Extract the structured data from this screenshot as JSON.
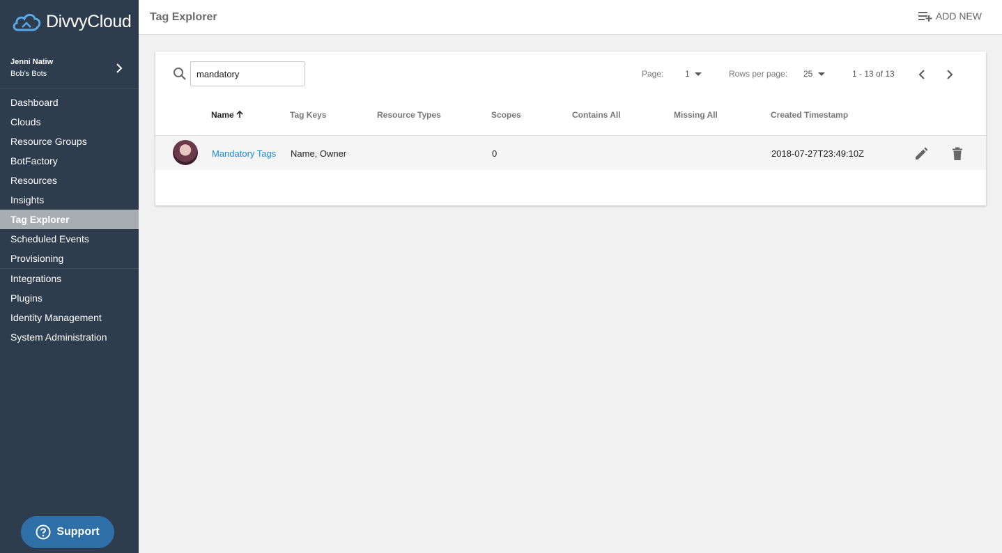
{
  "brand": {
    "name": "DivvyCloud"
  },
  "user": {
    "name": "Jenni Natiw",
    "org": "Bob's Bots"
  },
  "sidebar": {
    "items": [
      {
        "label": "Dashboard"
      },
      {
        "label": "Clouds"
      },
      {
        "label": "Resource Groups"
      },
      {
        "label": "BotFactory"
      },
      {
        "label": "Resources"
      },
      {
        "label": "Insights"
      },
      {
        "label": "Tag Explorer",
        "active": true
      },
      {
        "label": "Scheduled Events"
      },
      {
        "label": "Provisioning"
      },
      {
        "label": "Integrations"
      },
      {
        "label": "Plugins"
      },
      {
        "label": "Identity Management"
      },
      {
        "label": "System Administration"
      }
    ],
    "support_label": "Support"
  },
  "header": {
    "title": "Tag Explorer",
    "add_new_label": "ADD NEW"
  },
  "search": {
    "value": "mandatory"
  },
  "pager": {
    "page_label": "Page:",
    "page_value": "1",
    "rows_label": "Rows per page:",
    "rows_value": "25",
    "range_text": "1 - 13 of 13"
  },
  "table": {
    "columns": [
      "Name",
      "Tag Keys",
      "Resource Types",
      "Scopes",
      "Contains All",
      "Missing All",
      "Created Timestamp"
    ],
    "sorted_column": "Name",
    "sort_direction": "ascending",
    "rows": [
      {
        "name": "Mandatory Tags",
        "tag_keys": "Name, Owner",
        "resource_types": "",
        "scopes": "0",
        "contains_all": "",
        "missing_all": "",
        "created": "2018-07-27T23:49:10Z"
      }
    ]
  },
  "icons": {
    "search": "search-icon",
    "add_new": "playlist-add-icon",
    "edit": "pencil-icon",
    "delete": "trash-icon",
    "support": "help-circle-icon"
  },
  "colors": {
    "sidebar_bg": "#2e3d4d",
    "active_item_bg": "#a8adb2",
    "link": "#1b8ad6",
    "support_bg": "#2f6fa8"
  }
}
